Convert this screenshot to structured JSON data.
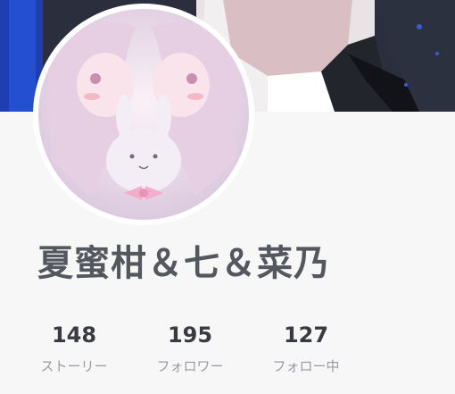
{
  "profile": {
    "name": "夏蜜柑＆七＆菜乃"
  },
  "stats": [
    {
      "value": "148",
      "label": "ストーリー"
    },
    {
      "value": "195",
      "label": "フォロワー"
    },
    {
      "value": "127",
      "label": "フォロー中"
    }
  ],
  "colors": {
    "background": "#f7f7f8",
    "name_text": "#55575e",
    "stat_value": "#3a3b40",
    "stat_label": "#9a9ba2"
  }
}
